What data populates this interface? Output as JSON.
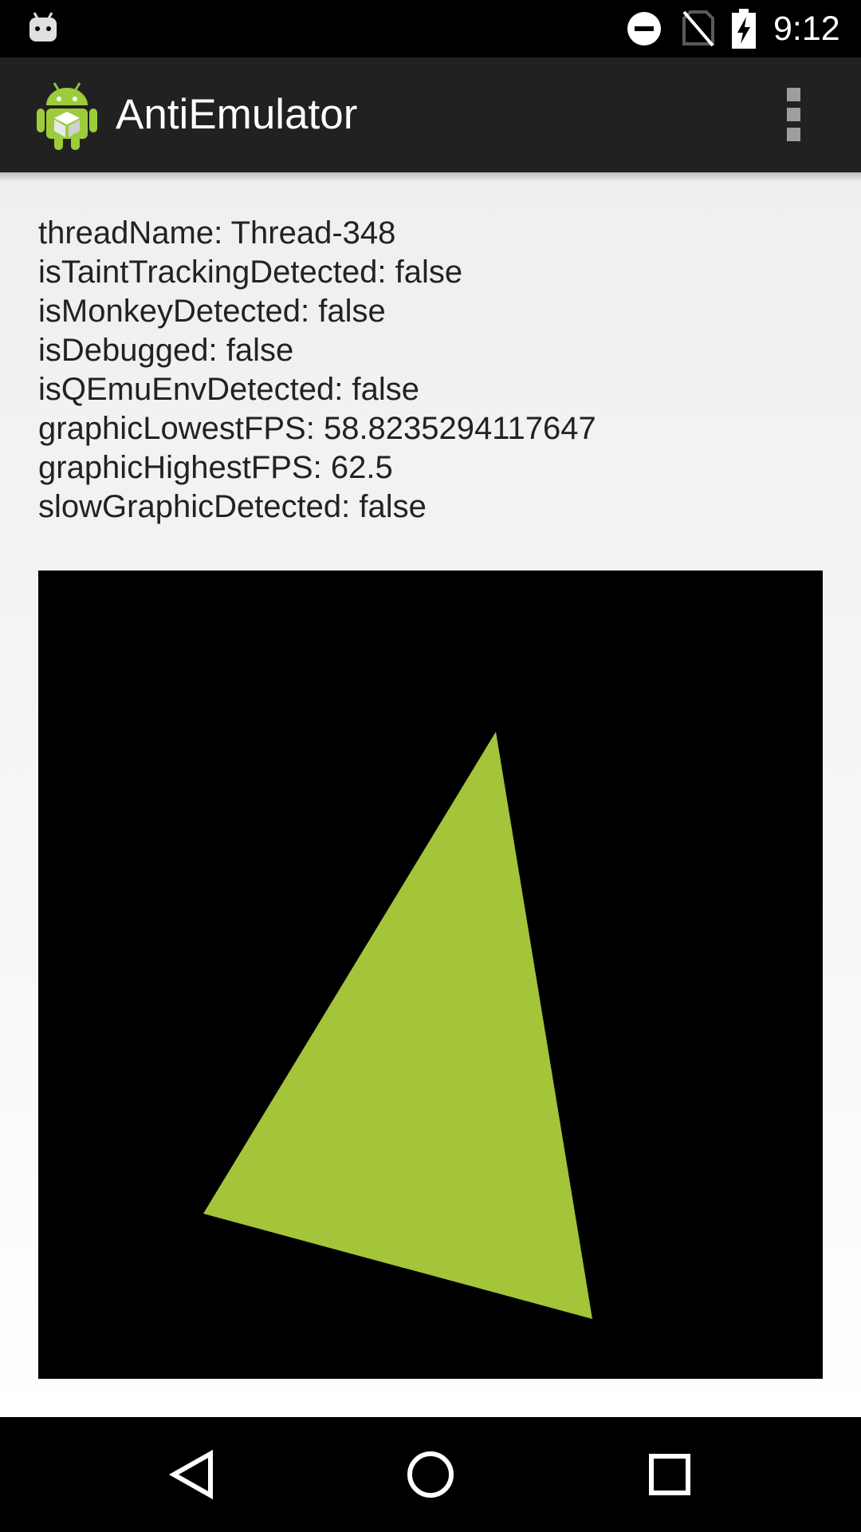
{
  "status_bar": {
    "time": "9:12",
    "icons": [
      "android-notification-icon",
      "do-not-disturb-icon",
      "no-sim-icon",
      "battery-charging-icon"
    ]
  },
  "app_bar": {
    "title": "AntiEmulator",
    "app_icon": "android-robot-icon",
    "menu_icon": "overflow-menu-icon"
  },
  "detection_results": [
    "threadName: Thread-348",
    "isTaintTrackingDetected: false",
    "isMonkeyDetected: false",
    "isDebugged: false",
    "isQEmuEnvDetected: false",
    "graphicLowestFPS: 58.8235294117647",
    "graphicHighestFPS: 62.5",
    "slowGraphicDetected: false"
  ],
  "gl_surface": {
    "background": "#000000",
    "triangle_color": "#a4c439"
  },
  "nav_bar": {
    "buttons": [
      "back-icon",
      "home-icon",
      "recents-icon"
    ]
  },
  "colors": {
    "app_bar": "#212121",
    "status_bar": "#000000",
    "content_text": "#222222",
    "accent": "#a4c439"
  }
}
